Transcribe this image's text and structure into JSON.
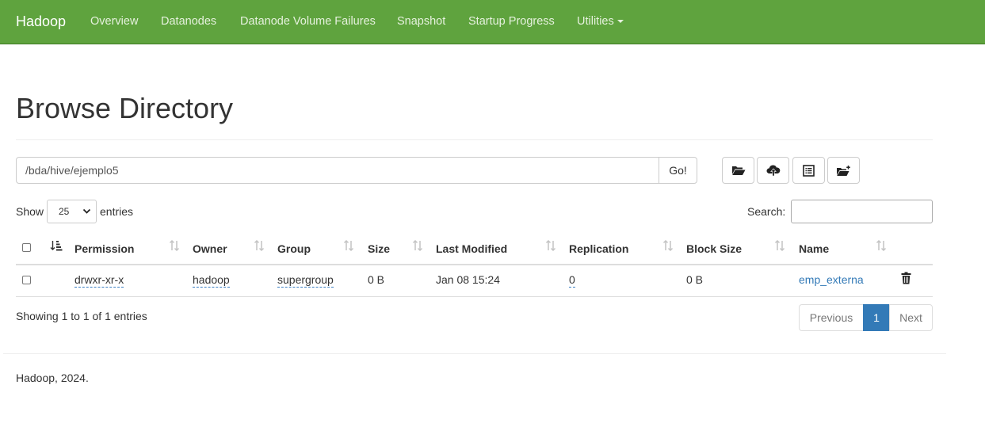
{
  "navbar": {
    "brand": "Hadoop",
    "items": [
      "Overview",
      "Datanodes",
      "Datanode Volume Failures",
      "Snapshot",
      "Startup Progress",
      "Utilities"
    ],
    "bg_color": "#5fa33e"
  },
  "page": {
    "title": "Browse Directory"
  },
  "path_bar": {
    "value": "/bda/hive/ejemplo5",
    "go_label": "Go!"
  },
  "toolbar": {
    "icons": [
      "folder-open-icon",
      "cloud-upload-icon",
      "list-alt-icon",
      "create-folder-icon"
    ]
  },
  "table_controls": {
    "show_label": "Show",
    "entries_value": "25",
    "entries_label": "entries",
    "search_label": "Search:"
  },
  "table": {
    "columns": [
      "Permission",
      "Owner",
      "Group",
      "Size",
      "Last Modified",
      "Replication",
      "Block Size",
      "Name"
    ],
    "rows": [
      {
        "permission": "drwxr-xr-x",
        "owner": "hadoop",
        "group": "supergroup",
        "size": "0 B",
        "last_modified": "Jan 08 15:24",
        "replication": "0",
        "block_size": "0 B",
        "name": "emp_externa"
      }
    ]
  },
  "pagination": {
    "info": "Showing 1 to 1 of 1 entries",
    "previous": "Previous",
    "current": "1",
    "next": "Next"
  },
  "footer": {
    "text": "Hadoop, 2024."
  }
}
